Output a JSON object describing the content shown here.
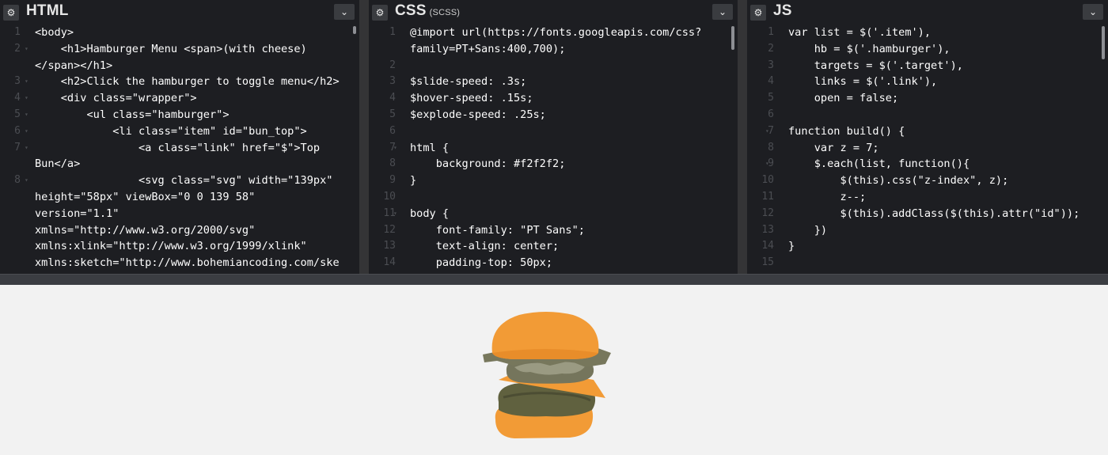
{
  "panels": {
    "html": {
      "title": "HTML",
      "lines": [
        {
          "n": "1",
          "fold": "",
          "text": "<body>"
        },
        {
          "n": "2",
          "fold": "▾",
          "text": "    <h1>Hamburger Menu <span>(with cheese)"
        },
        {
          "n": "",
          "fold": "",
          "text": "</span></h1>"
        },
        {
          "n": "3",
          "fold": "▾",
          "text": "    <h2>Click the hamburger to toggle menu</h2>"
        },
        {
          "n": "4",
          "fold": "▾",
          "text": "    <div class=\"wrapper\">"
        },
        {
          "n": "5",
          "fold": "▾",
          "text": "        <ul class=\"hamburger\">"
        },
        {
          "n": "6",
          "fold": "▾",
          "text": "            <li class=\"item\" id=\"bun_top\">"
        },
        {
          "n": "7",
          "fold": "▾",
          "text": "                <a class=\"link\" href=\"$\">Top"
        },
        {
          "n": "",
          "fold": "",
          "text": "Bun</a>"
        },
        {
          "n": "8",
          "fold": "▾",
          "text": "                <svg class=\"svg\" width=\"139px\""
        },
        {
          "n": "",
          "fold": "",
          "text": "height=\"58px\" viewBox=\"0 0 139 58\""
        },
        {
          "n": "",
          "fold": "",
          "text": "version=\"1.1\""
        },
        {
          "n": "",
          "fold": "",
          "text": "xmlns=\"http://www.w3.org/2000/svg\""
        },
        {
          "n": "",
          "fold": "",
          "text": "xmlns:xlink=\"http://www.w3.org/1999/xlink\""
        },
        {
          "n": "",
          "fold": "",
          "text": "xmlns:sketch=\"http://www.bohemiancoding.com/ske"
        }
      ]
    },
    "css": {
      "title": "CSS",
      "subtitle": "(SCSS)",
      "lines": [
        {
          "n": "1",
          "fold": "",
          "text": "@import url(https://fonts.googleapis.com/css?"
        },
        {
          "n": "",
          "fold": "",
          "text": "family=PT+Sans:400,700);"
        },
        {
          "n": "2",
          "fold": "",
          "text": ""
        },
        {
          "n": "3",
          "fold": "",
          "text": "$slide-speed: .3s;"
        },
        {
          "n": "4",
          "fold": "",
          "text": "$hover-speed: .15s;"
        },
        {
          "n": "5",
          "fold": "",
          "text": "$explode-speed: .25s;"
        },
        {
          "n": "6",
          "fold": "",
          "text": ""
        },
        {
          "n": "7",
          "fold": "▾",
          "text": "html {"
        },
        {
          "n": "8",
          "fold": "",
          "text": "    background: #f2f2f2;"
        },
        {
          "n": "9",
          "fold": "",
          "text": "}"
        },
        {
          "n": "10",
          "fold": "",
          "text": ""
        },
        {
          "n": "11",
          "fold": "▾",
          "text": "body {"
        },
        {
          "n": "12",
          "fold": "",
          "text": "    font-family: \"PT Sans\";"
        },
        {
          "n": "13",
          "fold": "",
          "text": "    text-align: center;"
        },
        {
          "n": "14",
          "fold": "",
          "text": "    padding-top: 50px;"
        }
      ]
    },
    "js": {
      "title": "JS",
      "lines": [
        {
          "n": "1",
          "fold": "",
          "text": "var list = $('.item'),"
        },
        {
          "n": "2",
          "fold": "",
          "text": "    hb = $('.hamburger'),"
        },
        {
          "n": "3",
          "fold": "",
          "text": "    targets = $('.target'),"
        },
        {
          "n": "4",
          "fold": "",
          "text": "    links = $('.link'),"
        },
        {
          "n": "5",
          "fold": "",
          "text": "    open = false;"
        },
        {
          "n": "6",
          "fold": "",
          "text": ""
        },
        {
          "n": "7",
          "fold": "▾",
          "text": "function build() {"
        },
        {
          "n": "8",
          "fold": "",
          "text": "    var z = 7;"
        },
        {
          "n": "9",
          "fold": "▾",
          "text": "    $.each(list, function(){"
        },
        {
          "n": "10",
          "fold": "",
          "text": "        $(this).css(\"z-index\", z);"
        },
        {
          "n": "11",
          "fold": "",
          "text": "        z--;"
        },
        {
          "n": "12",
          "fold": "",
          "text": "        $(this).addClass($(this).attr(\"id\"));"
        },
        {
          "n": "13",
          "fold": "",
          "text": "    })"
        },
        {
          "n": "14",
          "fold": "",
          "text": "}"
        },
        {
          "n": "15",
          "fold": "",
          "text": ""
        }
      ]
    }
  },
  "icons": {
    "settings": "gear-icon",
    "collapse": "chevron-down-icon"
  },
  "colors": {
    "editor_bg": "#1d1e22",
    "preview_bg": "#f2f2f2",
    "bun": "#f29b36",
    "patty": "#5f5f47",
    "lettuce": "#8c8a6a"
  }
}
